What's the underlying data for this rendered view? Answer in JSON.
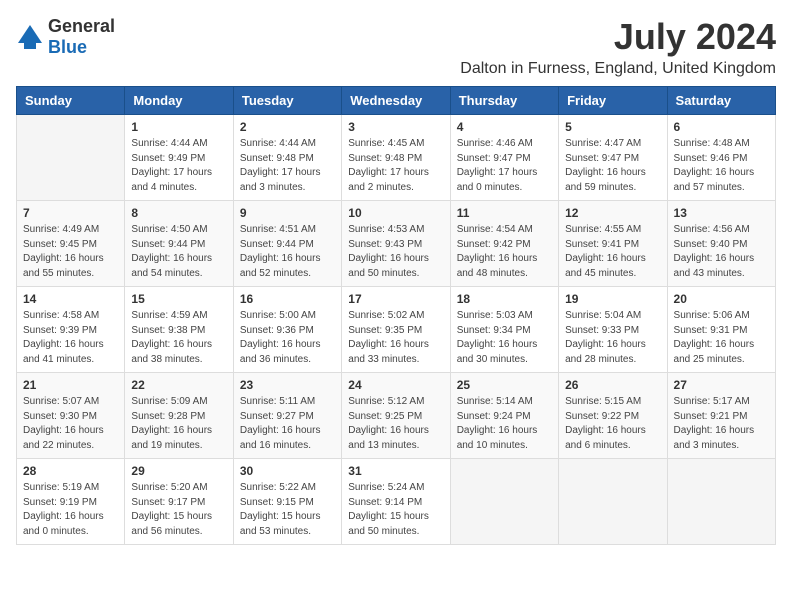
{
  "logo": {
    "general": "General",
    "blue": "Blue"
  },
  "title": "July 2024",
  "location": "Dalton in Furness, England, United Kingdom",
  "days_header": [
    "Sunday",
    "Monday",
    "Tuesday",
    "Wednesday",
    "Thursday",
    "Friday",
    "Saturday"
  ],
  "weeks": [
    [
      {
        "day": "",
        "info": ""
      },
      {
        "day": "1",
        "info": "Sunrise: 4:44 AM\nSunset: 9:49 PM\nDaylight: 17 hours\nand 4 minutes."
      },
      {
        "day": "2",
        "info": "Sunrise: 4:44 AM\nSunset: 9:48 PM\nDaylight: 17 hours\nand 3 minutes."
      },
      {
        "day": "3",
        "info": "Sunrise: 4:45 AM\nSunset: 9:48 PM\nDaylight: 17 hours\nand 2 minutes."
      },
      {
        "day": "4",
        "info": "Sunrise: 4:46 AM\nSunset: 9:47 PM\nDaylight: 17 hours\nand 0 minutes."
      },
      {
        "day": "5",
        "info": "Sunrise: 4:47 AM\nSunset: 9:47 PM\nDaylight: 16 hours\nand 59 minutes."
      },
      {
        "day": "6",
        "info": "Sunrise: 4:48 AM\nSunset: 9:46 PM\nDaylight: 16 hours\nand 57 minutes."
      }
    ],
    [
      {
        "day": "7",
        "info": "Sunrise: 4:49 AM\nSunset: 9:45 PM\nDaylight: 16 hours\nand 55 minutes."
      },
      {
        "day": "8",
        "info": "Sunrise: 4:50 AM\nSunset: 9:44 PM\nDaylight: 16 hours\nand 54 minutes."
      },
      {
        "day": "9",
        "info": "Sunrise: 4:51 AM\nSunset: 9:44 PM\nDaylight: 16 hours\nand 52 minutes."
      },
      {
        "day": "10",
        "info": "Sunrise: 4:53 AM\nSunset: 9:43 PM\nDaylight: 16 hours\nand 50 minutes."
      },
      {
        "day": "11",
        "info": "Sunrise: 4:54 AM\nSunset: 9:42 PM\nDaylight: 16 hours\nand 48 minutes."
      },
      {
        "day": "12",
        "info": "Sunrise: 4:55 AM\nSunset: 9:41 PM\nDaylight: 16 hours\nand 45 minutes."
      },
      {
        "day": "13",
        "info": "Sunrise: 4:56 AM\nSunset: 9:40 PM\nDaylight: 16 hours\nand 43 minutes."
      }
    ],
    [
      {
        "day": "14",
        "info": "Sunrise: 4:58 AM\nSunset: 9:39 PM\nDaylight: 16 hours\nand 41 minutes."
      },
      {
        "day": "15",
        "info": "Sunrise: 4:59 AM\nSunset: 9:38 PM\nDaylight: 16 hours\nand 38 minutes."
      },
      {
        "day": "16",
        "info": "Sunrise: 5:00 AM\nSunset: 9:36 PM\nDaylight: 16 hours\nand 36 minutes."
      },
      {
        "day": "17",
        "info": "Sunrise: 5:02 AM\nSunset: 9:35 PM\nDaylight: 16 hours\nand 33 minutes."
      },
      {
        "day": "18",
        "info": "Sunrise: 5:03 AM\nSunset: 9:34 PM\nDaylight: 16 hours\nand 30 minutes."
      },
      {
        "day": "19",
        "info": "Sunrise: 5:04 AM\nSunset: 9:33 PM\nDaylight: 16 hours\nand 28 minutes."
      },
      {
        "day": "20",
        "info": "Sunrise: 5:06 AM\nSunset: 9:31 PM\nDaylight: 16 hours\nand 25 minutes."
      }
    ],
    [
      {
        "day": "21",
        "info": "Sunrise: 5:07 AM\nSunset: 9:30 PM\nDaylight: 16 hours\nand 22 minutes."
      },
      {
        "day": "22",
        "info": "Sunrise: 5:09 AM\nSunset: 9:28 PM\nDaylight: 16 hours\nand 19 minutes."
      },
      {
        "day": "23",
        "info": "Sunrise: 5:11 AM\nSunset: 9:27 PM\nDaylight: 16 hours\nand 16 minutes."
      },
      {
        "day": "24",
        "info": "Sunrise: 5:12 AM\nSunset: 9:25 PM\nDaylight: 16 hours\nand 13 minutes."
      },
      {
        "day": "25",
        "info": "Sunrise: 5:14 AM\nSunset: 9:24 PM\nDaylight: 16 hours\nand 10 minutes."
      },
      {
        "day": "26",
        "info": "Sunrise: 5:15 AM\nSunset: 9:22 PM\nDaylight: 16 hours\nand 6 minutes."
      },
      {
        "day": "27",
        "info": "Sunrise: 5:17 AM\nSunset: 9:21 PM\nDaylight: 16 hours\nand 3 minutes."
      }
    ],
    [
      {
        "day": "28",
        "info": "Sunrise: 5:19 AM\nSunset: 9:19 PM\nDaylight: 16 hours\nand 0 minutes."
      },
      {
        "day": "29",
        "info": "Sunrise: 5:20 AM\nSunset: 9:17 PM\nDaylight: 15 hours\nand 56 minutes."
      },
      {
        "day": "30",
        "info": "Sunrise: 5:22 AM\nSunset: 9:15 PM\nDaylight: 15 hours\nand 53 minutes."
      },
      {
        "day": "31",
        "info": "Sunrise: 5:24 AM\nSunset: 9:14 PM\nDaylight: 15 hours\nand 50 minutes."
      },
      {
        "day": "",
        "info": ""
      },
      {
        "day": "",
        "info": ""
      },
      {
        "day": "",
        "info": ""
      }
    ]
  ]
}
